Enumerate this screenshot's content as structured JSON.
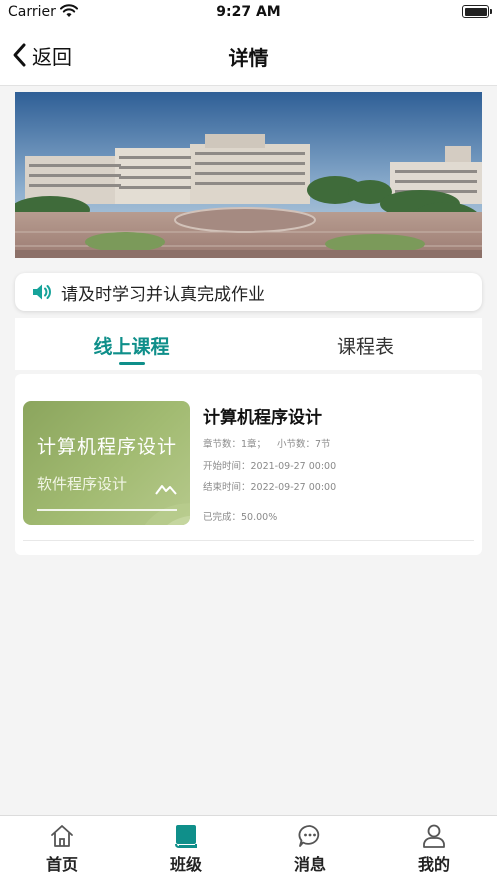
{
  "status_bar": {
    "carrier": "Carrier",
    "time": "9:27 AM"
  },
  "nav": {
    "back_label": "返回",
    "title": "详情"
  },
  "notice": {
    "text": "请及时学习并认真完成作业"
  },
  "tabs": [
    {
      "label": "线上课程",
      "active": true
    },
    {
      "label": "课程表",
      "active": false
    }
  ],
  "course": {
    "thumb_title": "计算机程序设计",
    "thumb_subtitle": "软件程序设计",
    "title": "计算机程序设计",
    "chapters": "章节数：1章；",
    "sections": "小节数：7节",
    "start_time": "开始时间：2021-09-27 00:00",
    "end_time": "结束时间：2022-09-27 00:00",
    "completion": "已完成：50.00%",
    "completion_fraction": 0.5
  },
  "bottom_tabs": [
    {
      "label": "首页",
      "icon": "home-icon"
    },
    {
      "label": "班级",
      "icon": "book-icon",
      "active": true
    },
    {
      "label": "消息",
      "icon": "message-icon"
    },
    {
      "label": "我的",
      "icon": "user-icon"
    }
  ],
  "colors": {
    "accent": "#0f8f8a",
    "background": "#f4f4f4"
  }
}
